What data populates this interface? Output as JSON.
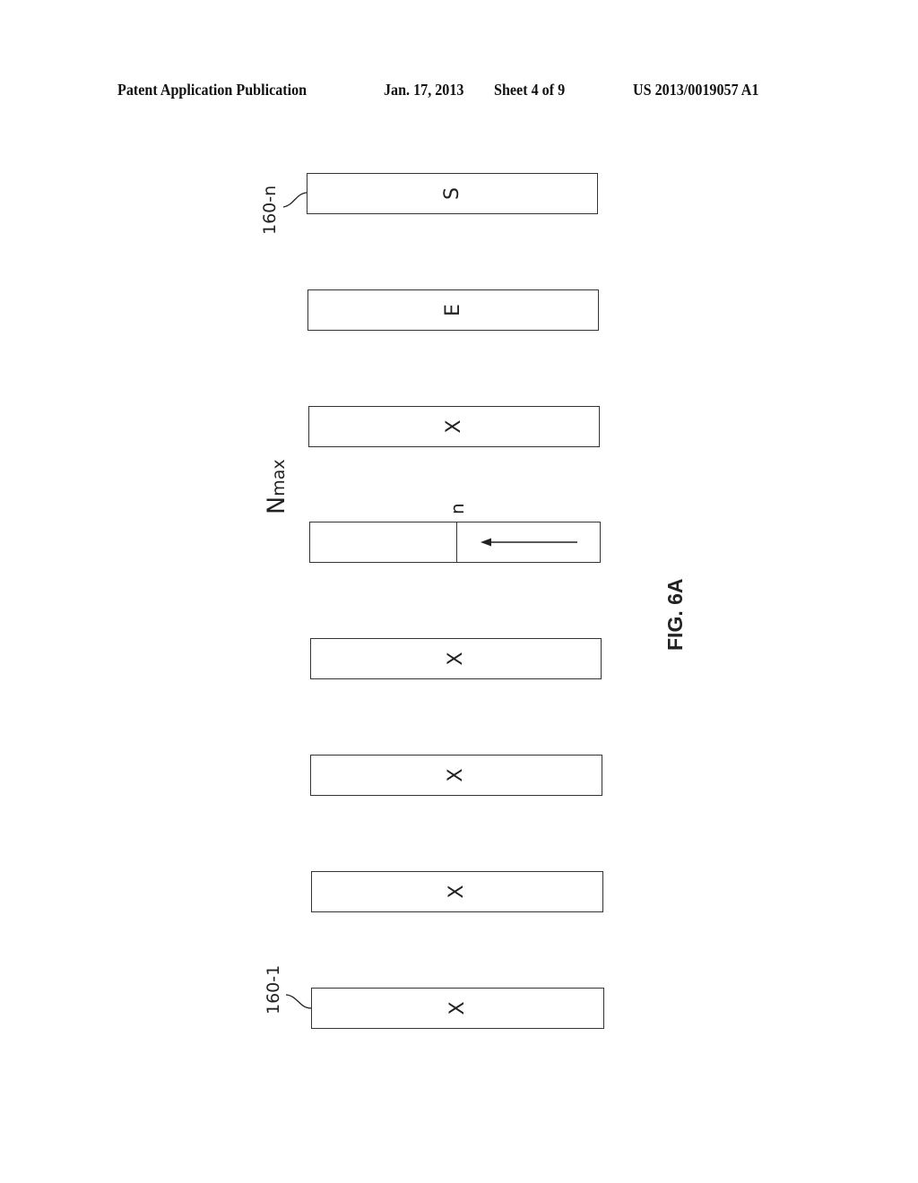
{
  "header": {
    "publication_type": "Patent Application Publication",
    "date": "Jan. 17, 2013",
    "sheet": "Sheet 4 of 9",
    "pub_number": "US 2013/0019057 A1"
  },
  "figure": {
    "caption": "FIG. 6A",
    "label_top_cell": "160-n",
    "label_bottom_cell": "160-1",
    "nmax_label_base": "N",
    "nmax_label_sub": "max",
    "pointer_label": "n",
    "cells": [
      {
        "symbol": "S"
      },
      {
        "symbol": "E"
      },
      {
        "symbol": "X"
      },
      {
        "symbol": "",
        "split": true,
        "arrow": "left"
      },
      {
        "symbol": "X"
      },
      {
        "symbol": "X"
      },
      {
        "symbol": "X"
      },
      {
        "symbol": "X"
      }
    ]
  }
}
